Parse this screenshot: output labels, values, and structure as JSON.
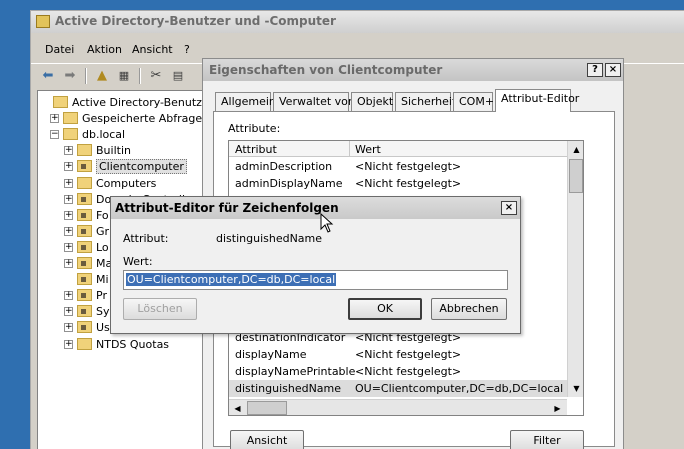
{
  "main_window": {
    "title": "Active Directory-Benutzer und -Computer",
    "menu": [
      "Datei",
      "Aktion",
      "Ansicht",
      "?"
    ],
    "tree": [
      {
        "label": "Active Directory-Benutzer und -Computer",
        "indent": 0,
        "expander": ""
      },
      {
        "label": "Gespeicherte Abfragen",
        "indent": 1,
        "expander": "+"
      },
      {
        "label": "db.local",
        "indent": 1,
        "expander": "−"
      },
      {
        "label": "Builtin",
        "indent": 2,
        "expander": "+"
      },
      {
        "label": "Clientcomputer",
        "indent": 2,
        "expander": "+",
        "selected": true
      },
      {
        "label": "Computers",
        "indent": 2,
        "expander": "+"
      },
      {
        "label": "Domain Controllers",
        "indent": 2,
        "expander": "+"
      },
      {
        "label": "Fo",
        "indent": 2,
        "expander": "+"
      },
      {
        "label": "Gr",
        "indent": 2,
        "expander": "+"
      },
      {
        "label": "Lo",
        "indent": 2,
        "expander": "+"
      },
      {
        "label": "Ma",
        "indent": 2,
        "expander": "+"
      },
      {
        "label": "Mi",
        "indent": 2,
        "expander": ""
      },
      {
        "label": "Pr",
        "indent": 2,
        "expander": "+"
      },
      {
        "label": "Sy",
        "indent": 2,
        "expander": "+"
      },
      {
        "label": "Us",
        "indent": 2,
        "expander": "+"
      },
      {
        "label": "NTDS Quotas",
        "indent": 2,
        "expander": "+"
      }
    ]
  },
  "properties_dialog": {
    "title": "Eigenschaften von Clientcomputer",
    "help_button": "?",
    "close_button": "×",
    "tabs": [
      "Allgemein",
      "Verwaltet von",
      "Objekt",
      "Sicherheit",
      "COM+",
      "Attribut-Editor"
    ],
    "active_tab": "Attribut-Editor",
    "attributes_label": "Attribute:",
    "columns": [
      "Attribut",
      "Wert"
    ],
    "rows": [
      {
        "attr": "adminDescription",
        "value": "<Nicht festgelegt>"
      },
      {
        "attr": "adminDisplayName",
        "value": "<Nicht festgelegt>"
      },
      {
        "attr": "",
        "value": ""
      },
      {
        "attr": "",
        "value": ""
      },
      {
        "attr": "",
        "value": ""
      },
      {
        "attr": "",
        "value": ""
      },
      {
        "attr": "",
        "value": ""
      },
      {
        "attr": "",
        "value": ""
      },
      {
        "attr": "",
        "value": ""
      },
      {
        "attr": "",
        "value": ""
      },
      {
        "attr": "destinationIndicator",
        "value": "<Nicht festgelegt>"
      },
      {
        "attr": "displayName",
        "value": "<Nicht festgelegt>"
      },
      {
        "attr": "displayNamePrintable",
        "value": "<Nicht festgelegt>"
      },
      {
        "attr": "distinguishedName",
        "value": "OU=Clientcomputer,DC=db,DC=local",
        "selected": true
      }
    ],
    "view_button": "Ansicht",
    "filter_button": "Filter"
  },
  "string_editor": {
    "title": "Attribut-Editor für Zeichenfolgen",
    "close_button": "×",
    "attribute_label": "Attribut:",
    "attribute_value": "distinguishedName",
    "value_label": "Wert:",
    "value": "OU=Clientcomputer,DC=db,DC=local",
    "clear_button": "Löschen",
    "ok_button": "OK",
    "cancel_button": "Abbrechen"
  }
}
